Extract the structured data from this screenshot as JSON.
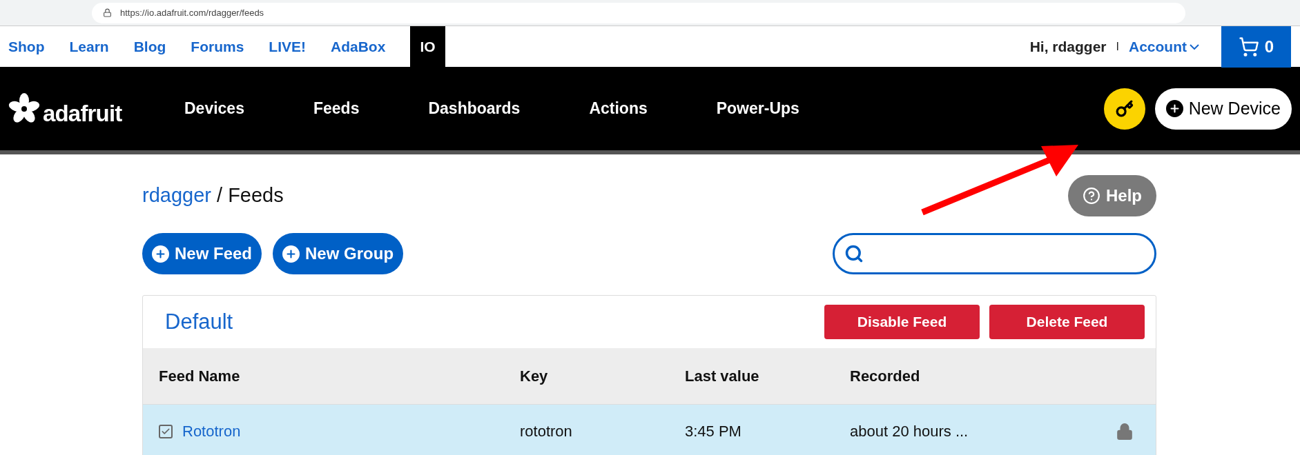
{
  "browser": {
    "url": "https://io.adafruit.com/rdagger/feeds"
  },
  "top_nav": {
    "items": [
      {
        "label": "Shop",
        "selected": false
      },
      {
        "label": "Learn",
        "selected": false
      },
      {
        "label": "Blog",
        "selected": false
      },
      {
        "label": "Forums",
        "selected": false
      },
      {
        "label": "LIVE!",
        "selected": false
      },
      {
        "label": "AdaBox",
        "selected": false
      },
      {
        "label": "IO",
        "selected": true
      }
    ],
    "greeting": "Hi, rdagger",
    "separator": "I",
    "account": "Account",
    "cart_count": "0"
  },
  "header": {
    "logo": "adafruit",
    "nav": [
      "Devices",
      "Feeds",
      "Dashboards",
      "Actions",
      "Power-Ups"
    ],
    "new_device": "New Device"
  },
  "page": {
    "breadcrumb_user": "rdagger",
    "breadcrumb_page": "/ Feeds",
    "help": "Help",
    "new_feed": "New Feed",
    "new_group": "New Group"
  },
  "group": {
    "title": "Default",
    "buttons": [
      "Disable Feed",
      "Delete Feed"
    ],
    "columns": [
      "Feed Name",
      "Key",
      "Last value",
      "Recorded"
    ],
    "rows": [
      {
        "name": "Rototron",
        "key": "rototron",
        "last_value": "3:45 PM",
        "recorded": "about 20 hours ...",
        "checked": true,
        "selected": true,
        "locked": true
      }
    ]
  }
}
